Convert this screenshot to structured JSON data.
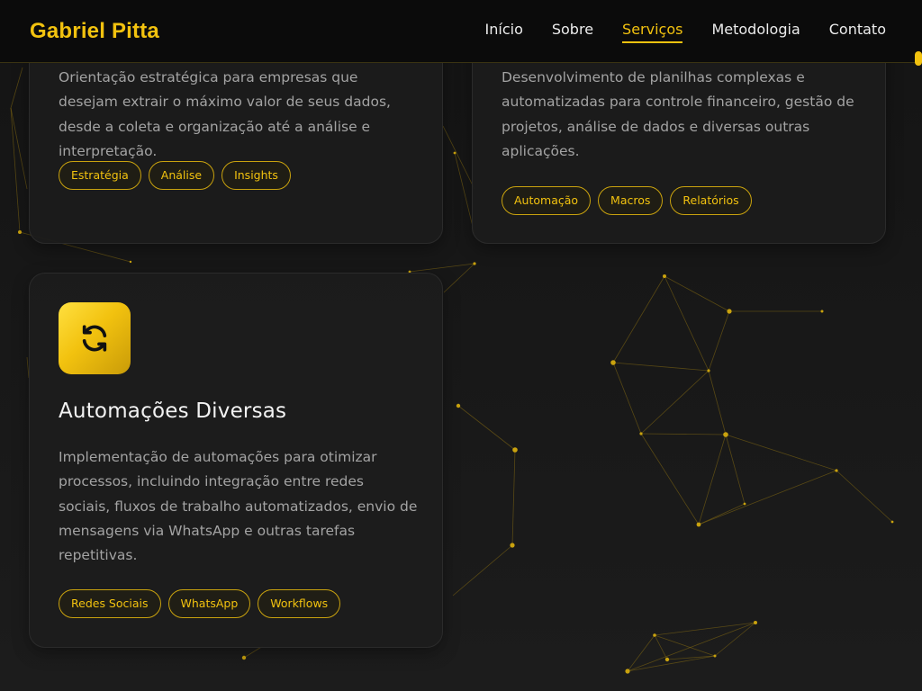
{
  "header": {
    "logo": "Gabriel Pitta",
    "nav": [
      {
        "label": "Início",
        "active": false
      },
      {
        "label": "Sobre",
        "active": false
      },
      {
        "label": "Serviços",
        "active": true
      },
      {
        "label": "Metodologia",
        "active": false
      },
      {
        "label": "Contato",
        "active": false
      }
    ]
  },
  "colors": {
    "accent": "#f2c20f",
    "background": "#161616",
    "card": "#1c1c1c",
    "text_muted": "#a3a3a3"
  },
  "services": [
    {
      "description": "Orientação estratégica para empresas que desejam extrair o máximo valor de seus dados, desde a coleta e organização até a análise e interpretação.",
      "tags": [
        "Estratégia",
        "Análise",
        "Insights"
      ]
    },
    {
      "description": "Desenvolvimento de planilhas complexas e automatizadas para controle financeiro, gestão de projetos, análise de dados e diversas outras aplicações.",
      "tags": [
        "Automação",
        "Macros",
        "Relatórios"
      ]
    },
    {
      "icon": "refresh-icon",
      "title": "Automações Diversas",
      "description": "Implementação de automações para otimizar processos, incluindo integração entre redes sociais, fluxos de trabalho automatizados, envio de mensagens via WhatsApp e outras tarefas repetitivas.",
      "tags": [
        "Redes Sociais",
        "WhatsApp",
        "Workflows"
      ]
    }
  ]
}
